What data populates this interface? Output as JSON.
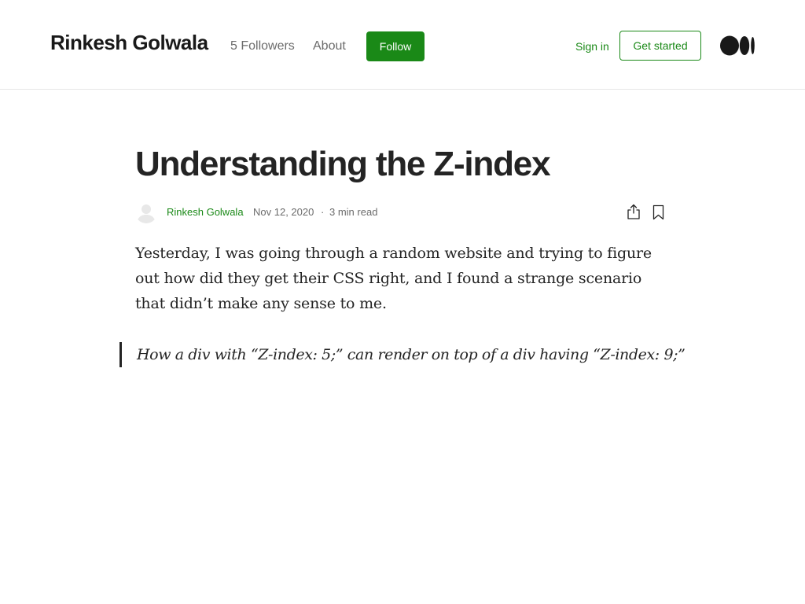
{
  "header": {
    "publication_name": "Rinkesh Golwala",
    "followers_label": "5 Followers",
    "about_label": "About",
    "follow_label": "Follow",
    "sign_in_label": "Sign in",
    "get_started_label": "Get started",
    "logo_icon": "medium-logo-icon"
  },
  "article": {
    "title": "Understanding the Z-index",
    "author": "Rinkesh Golwala",
    "date": "Nov 12, 2020",
    "separator": "·",
    "read_time": "3 min read",
    "paragraph": "Yesterday, I was going through a random website and trying to figure out how did they get their CSS right, and I found a strange scenario that didn’t make any sense to me.",
    "blockquote": "How a div with “Z-index: 5;” can render on top of a div having “Z-index: 9;”"
  },
  "icons": {
    "avatar": "user-avatar-icon",
    "share": "share-icon",
    "bookmark": "bookmark-icon"
  },
  "colors": {
    "accent_green": "#1a8917",
    "text_primary": "#242424",
    "text_secondary": "#6b6b6b",
    "divider": "#e6e6e6"
  }
}
